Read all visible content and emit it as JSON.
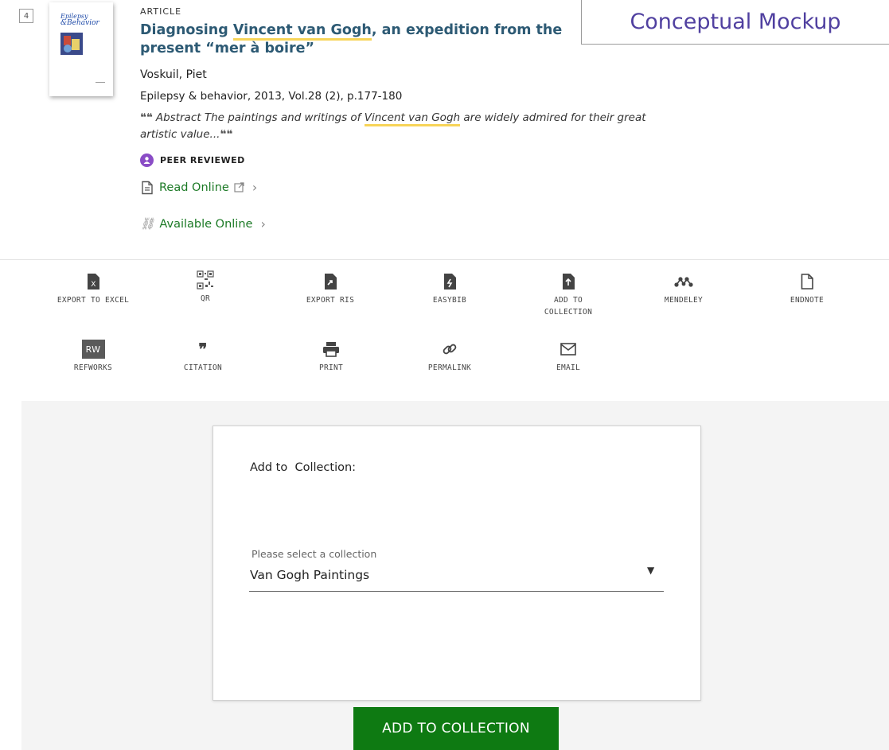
{
  "result": {
    "number": "4",
    "thumbnail": {
      "journal_line1": "Epilepsy",
      "journal_line2": "&Behavior"
    },
    "type": "ARTICLE",
    "title_pre": "Diagnosing ",
    "title_highlight": "Vincent van Gogh",
    "title_post": ", an expedition from the",
    "title_line2": "present “mer à boire”",
    "authors": "Voskuil, Piet",
    "source": "Epilepsy & behavior, 2013, Vol.28 (2), p.177-180",
    "abstract_pre": "Abstract The paintings and writings of ",
    "abstract_highlight": "Vincent van Gogh",
    "abstract_post": " are widely admired for their great",
    "abstract_line2": "artistic value...",
    "peer_reviewed": "PEER REVIEWED",
    "read_online": "Read Online",
    "available_online": "Available Online"
  },
  "watermark": "Conceptual Mockup",
  "actions": [
    {
      "label": "EXPORT TO EXCEL",
      "icon": "excel-icon"
    },
    {
      "label": "QR",
      "icon": "qr-icon"
    },
    {
      "label": "EXPORT RIS",
      "icon": "export-ris-icon"
    },
    {
      "label": "EASYBIB",
      "icon": "easybib-icon"
    },
    {
      "label": "ADD TO COLLECTION",
      "icon": "add-to-collection-icon"
    },
    {
      "label": "MENDELEY",
      "icon": "mendeley-icon"
    },
    {
      "label": "ENDNOTE",
      "icon": "endnote-icon"
    },
    {
      "label": "REFWORKS",
      "icon": "refworks-icon",
      "badge": "RW"
    },
    {
      "label": "CITATION",
      "icon": "quote-icon"
    },
    {
      "label": "PRINT",
      "icon": "print-icon"
    },
    {
      "label": "PERMALINK",
      "icon": "link-icon"
    },
    {
      "label": "EMAIL",
      "icon": "email-icon"
    }
  ],
  "panel": {
    "heading": "Add to  Collection:",
    "select_label": "Please select a collection",
    "select_value": "Van Gogh Paintings",
    "button": "ADD TO COLLECTION"
  },
  "colors": {
    "title": "#2d5a74",
    "link": "#1c7a26",
    "button": "#0e7a12",
    "highlight": "#f7d458",
    "peer_icon": "#8a4cc6"
  }
}
